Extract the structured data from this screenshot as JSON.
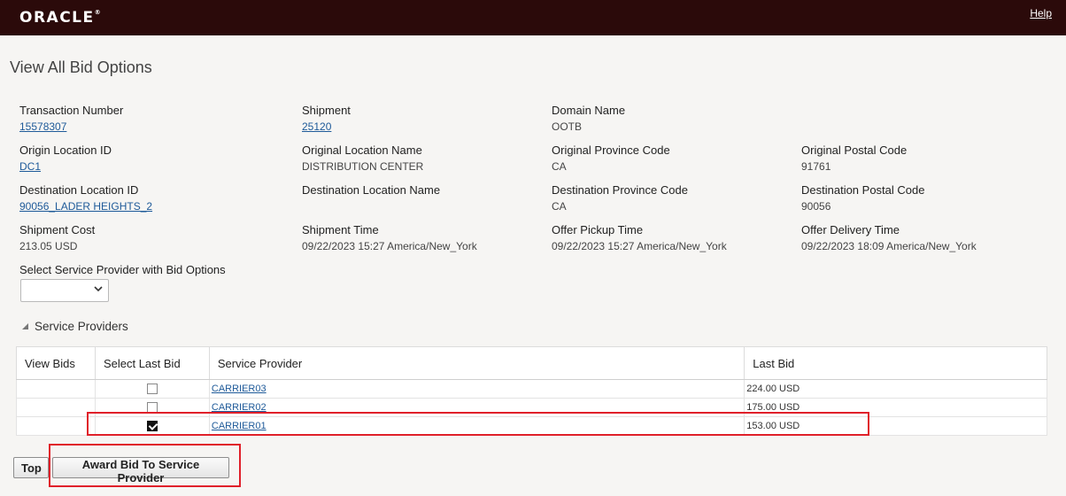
{
  "header": {
    "logo_text": "ORACLE",
    "help_label": "Help"
  },
  "page": {
    "title": "View All Bid Options"
  },
  "fields": {
    "transaction_number": {
      "label": "Transaction Number",
      "value": "15578307"
    },
    "shipment": {
      "label": "Shipment",
      "value": "25120"
    },
    "domain_name": {
      "label": "Domain Name",
      "value": "OOTB"
    },
    "origin_location_id": {
      "label": "Origin Location ID",
      "value": "DC1"
    },
    "original_location_name": {
      "label": "Original Location Name",
      "value": "DISTRIBUTION CENTER"
    },
    "original_province_code": {
      "label": "Original Province Code",
      "value": "CA"
    },
    "original_postal_code": {
      "label": "Original Postal Code",
      "value": "91761"
    },
    "destination_location_id": {
      "label": "Destination Location ID",
      "value": "90056_LADER HEIGHTS_2"
    },
    "destination_location_name": {
      "label": "Destination Location Name",
      "value": ""
    },
    "destination_province_code": {
      "label": "Destination Province Code",
      "value": "CA"
    },
    "destination_postal_code": {
      "label": "Destination Postal Code",
      "value": "90056"
    },
    "shipment_cost": {
      "label": "Shipment Cost",
      "value": "213.05 USD"
    },
    "shipment_time": {
      "label": "Shipment Time",
      "value": "09/22/2023 15:27 America/New_York"
    },
    "offer_pickup_time": {
      "label": "Offer Pickup Time",
      "value": "09/22/2023 15:27 America/New_York"
    },
    "offer_delivery_time": {
      "label": "Offer Delivery Time",
      "value": "09/22/2023 18:09 America/New_York"
    }
  },
  "provider_select": {
    "label": "Select Service Provider with Bid Options",
    "value": ""
  },
  "service_providers": {
    "section_label": "Service Providers",
    "columns": [
      "View Bids",
      "Select Last Bid",
      "Service Provider",
      "Last Bid"
    ],
    "rows": [
      {
        "view_bids": "",
        "selected": false,
        "provider": "CARRIER03",
        "last_bid": "224.00 USD"
      },
      {
        "view_bids": "",
        "selected": false,
        "provider": "CARRIER02",
        "last_bid": "175.00 USD"
      },
      {
        "view_bids": "",
        "selected": true,
        "provider": "CARRIER01",
        "last_bid": "153.00 USD"
      }
    ]
  },
  "buttons": {
    "top_label": "Top",
    "award_label": "Award Bid To Service Provider"
  },
  "colors": {
    "header_bg": "#2b0a0a",
    "link": "#1e5a99",
    "highlight": "#e0202a"
  }
}
